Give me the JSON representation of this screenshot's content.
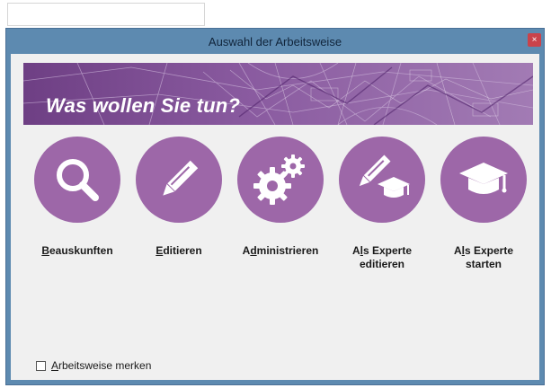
{
  "window": {
    "title": "Auswahl der Arbeitsweise",
    "close_glyph": "×"
  },
  "banner": {
    "text": "Was wollen Sie tun?",
    "accent_color": "#7a4a8e"
  },
  "actions": [
    {
      "key": "B",
      "rest": "eauskunften",
      "icon": "search-icon"
    },
    {
      "key": "E",
      "rest": "ditieren",
      "icon": "pencil-icon"
    },
    {
      "pre": "A",
      "key": "d",
      "rest": "ministrieren",
      "icon": "gears-icon"
    },
    {
      "pre": "A",
      "key": "l",
      "rest": "s Experte",
      "line2": "editieren",
      "icon": "pencil-graduation-cap-icon"
    },
    {
      "pre": "A",
      "key": "l",
      "rest": "s Experte",
      "line2": "starten",
      "icon": "graduation-cap-icon"
    }
  ],
  "remember": {
    "key": "A",
    "rest": "rbeitsweise merken",
    "checked": false
  },
  "colors": {
    "circle": "#9d67a8",
    "window_border": "#5d8ab0",
    "client_bg": "#f0f0f0"
  }
}
